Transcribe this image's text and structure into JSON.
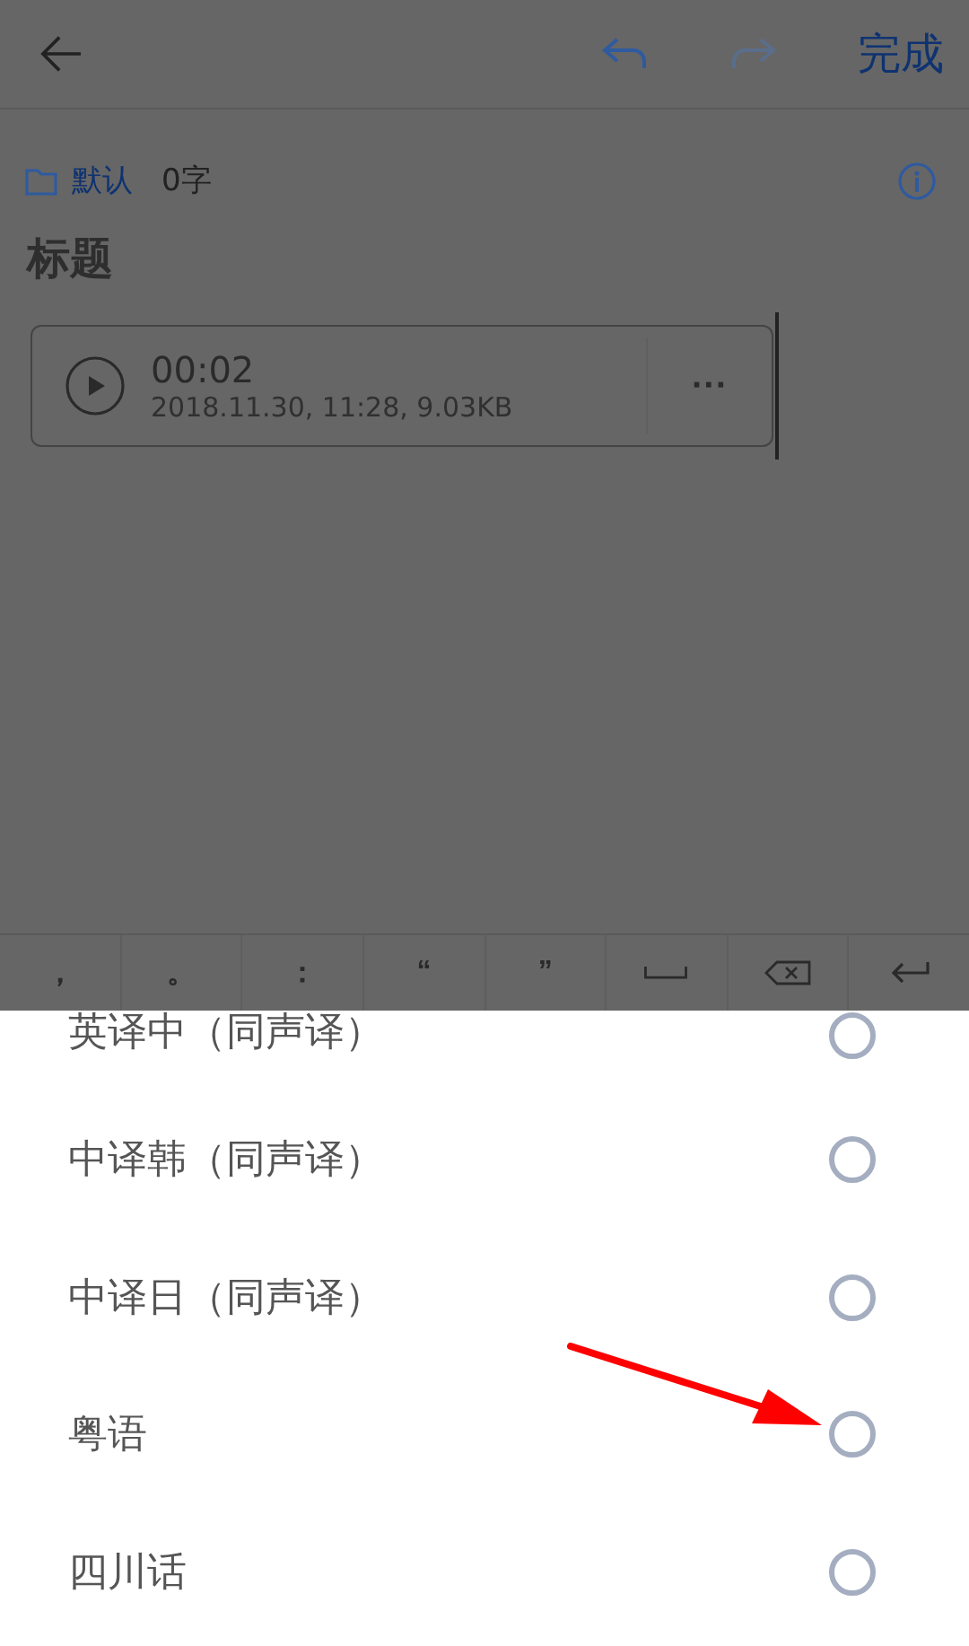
{
  "header": {
    "done_label": "完成",
    "undo_enabled": true,
    "redo_enabled": false
  },
  "note": {
    "folder": "默认",
    "word_count": "0字",
    "title_placeholder": "标题"
  },
  "audio": {
    "duration": "00:02",
    "details": "2018.11.30, 11:28, 9.03KB",
    "more": "···"
  },
  "toolbar": [
    {
      "kind": "char",
      "label": "，"
    },
    {
      "kind": "char",
      "label": "。"
    },
    {
      "kind": "char",
      "label": "："
    },
    {
      "kind": "char",
      "label": "“"
    },
    {
      "kind": "char",
      "label": "”"
    },
    {
      "kind": "space"
    },
    {
      "kind": "backspace"
    },
    {
      "kind": "enter"
    }
  ],
  "options": [
    {
      "label": "英译中（同声译）",
      "selected": false
    },
    {
      "label": "中译韩（同声译）",
      "selected": false
    },
    {
      "label": "中译日（同声译）",
      "selected": false
    },
    {
      "label": "粤语",
      "selected": false
    },
    {
      "label": "四川话",
      "selected": false
    }
  ]
}
